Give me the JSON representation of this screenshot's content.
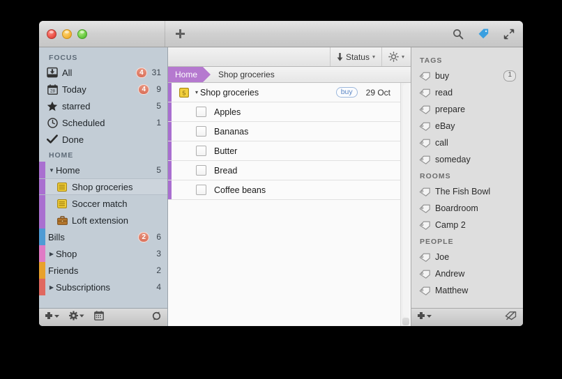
{
  "window": {
    "traffic_lights": [
      "close",
      "minimize",
      "maximize"
    ],
    "toolbar": {
      "add_label": "+",
      "search_icon": "search-icon",
      "tag_icon": "tag-icon",
      "fullscreen_icon": "fullscreen-icon"
    }
  },
  "sidebar": {
    "sections": [
      {
        "header": "FOCUS",
        "items": [
          {
            "label": "All",
            "icon": "inbox-icon",
            "badge": "4",
            "count": "31",
            "color": ""
          },
          {
            "label": "Today",
            "icon": "calendar-icon",
            "badge": "4",
            "count": "9",
            "color": ""
          },
          {
            "label": "starred",
            "icon": "star-icon",
            "badge": "",
            "count": "5",
            "color": ""
          },
          {
            "label": "Scheduled",
            "icon": "clock-icon",
            "badge": "",
            "count": "1",
            "color": ""
          },
          {
            "label": "Done",
            "icon": "check-icon",
            "badge": "",
            "count": "",
            "color": ""
          }
        ]
      },
      {
        "header": "HOME",
        "items": [
          {
            "label": "Home",
            "icon": "",
            "badge": "",
            "count": "5",
            "color": "#a96fd0",
            "disclosure": "down",
            "indent": 1,
            "selected": false
          },
          {
            "label": "Shop groceries",
            "icon": "list-icon",
            "badge": "",
            "count": "",
            "color": "#a96fd0",
            "disclosure": "",
            "indent": 2,
            "selected": true
          },
          {
            "label": "Soccer match",
            "icon": "list-icon",
            "badge": "",
            "count": "",
            "color": "#a96fd0",
            "disclosure": "",
            "indent": 2,
            "selected": false
          },
          {
            "label": "Loft extension",
            "icon": "briefcase-icon",
            "badge": "",
            "count": "",
            "color": "#a96fd0",
            "disclosure": "",
            "indent": 2,
            "selected": false
          },
          {
            "label": "Bills",
            "icon": "",
            "badge": "2",
            "count": "6",
            "color": "#4f9bd4",
            "disclosure": "",
            "indent": 1,
            "selected": false
          },
          {
            "label": "Shop",
            "icon": "",
            "badge": "",
            "count": "3",
            "color": "#e07bc5",
            "disclosure": "right",
            "indent": 1,
            "selected": false
          },
          {
            "label": "Friends",
            "icon": "",
            "badge": "",
            "count": "2",
            "color": "#e8a12c",
            "disclosure": "",
            "indent": 1,
            "selected": false
          },
          {
            "label": "Subscriptions",
            "icon": "",
            "badge": "",
            "count": "4",
            "color": "#e0685f",
            "disclosure": "right",
            "indent": 1,
            "selected": false
          }
        ]
      }
    ],
    "bottom_bar": {
      "add_icon": "plus-dropdown-icon",
      "settings_icon": "gear-dropdown-icon",
      "calendar_icon": "calendar-icon",
      "sync_icon": "refresh-icon"
    }
  },
  "main": {
    "statusbar": {
      "sort_label": "Status",
      "sort_direction_icon": "arrow-down-icon",
      "sort_caret": "▾",
      "display_icon": "brightness-icon",
      "display_caret": "▾"
    },
    "breadcrumb": {
      "root": "Home",
      "current": "Shop groceries"
    },
    "task": {
      "icon": "list-icon",
      "icon_number": "5",
      "disclosure": "▾",
      "title": "Shop groceries",
      "tag": "buy",
      "date": "29 Oct"
    },
    "items": [
      {
        "label": "Apples",
        "checked": false
      },
      {
        "label": "Bananas",
        "checked": false
      },
      {
        "label": "Butter",
        "checked": false
      },
      {
        "label": "Bread",
        "checked": false
      },
      {
        "label": "Coffee beans",
        "checked": false
      }
    ],
    "strip_color": "#a96fd0"
  },
  "tags_panel": {
    "sections": [
      {
        "header": "TAGS",
        "items": [
          {
            "label": "buy",
            "count": "1"
          },
          {
            "label": "read",
            "count": ""
          },
          {
            "label": "prepare",
            "count": ""
          },
          {
            "label": "eBay",
            "count": ""
          },
          {
            "label": "call",
            "count": ""
          },
          {
            "label": "someday",
            "count": ""
          }
        ]
      },
      {
        "header": "ROOMS",
        "items": [
          {
            "label": "The Fish Bowl",
            "count": ""
          },
          {
            "label": "Boardroom",
            "count": ""
          },
          {
            "label": "Camp 2",
            "count": ""
          }
        ]
      },
      {
        "header": "PEOPLE",
        "items": [
          {
            "label": "Joe",
            "count": ""
          },
          {
            "label": "Andrew",
            "count": ""
          },
          {
            "label": "Matthew",
            "count": ""
          }
        ]
      }
    ],
    "bottom_bar": {
      "add_icon": "plus-dropdown-icon",
      "hide_icon": "tag-hidden-icon"
    }
  },
  "colors": {
    "accent_purple": "#a96fd0",
    "badge_orange": "#d9705a",
    "tag_blue": "#5b86c4",
    "toolbar_tag_blue": "#3a9fe0"
  }
}
